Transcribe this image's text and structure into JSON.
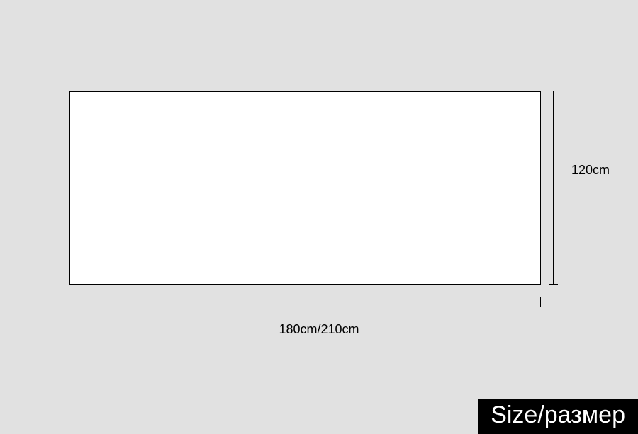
{
  "dimensions": {
    "height_label": "120cm",
    "width_label": "180cm/210cm"
  },
  "tag": {
    "label": "Size/размер"
  }
}
